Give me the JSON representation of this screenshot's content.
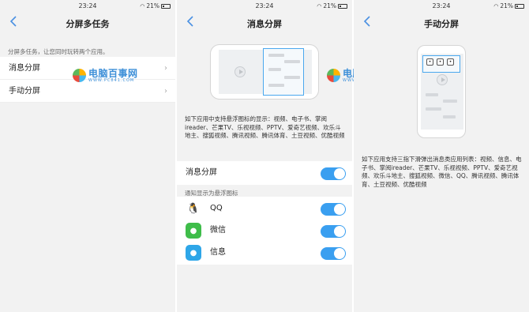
{
  "status": {
    "time": "23:24",
    "battery": "21%"
  },
  "screen1": {
    "title": "分屏多任务",
    "hint": "分屏多任务，让您同时玩转两个应用。",
    "items": [
      {
        "label": "消息分屏"
      },
      {
        "label": "手动分屏"
      }
    ]
  },
  "screen2": {
    "title": "消息分屏",
    "desc": "如下应用中支持悬浮图标的显示：视频、电子书、掌阅ireader、芒果TV、乐视视频、PPTV、爱奇艺视频、欢乐斗地主、搜狐视频、腾讯视频、腾讯体育、土豆视频、优酷视频",
    "toggle_label": "消息分屏",
    "section": "通知显示为悬浮图标",
    "apps": [
      {
        "label": "QQ",
        "icon": "qq-icon"
      },
      {
        "label": "微信",
        "icon": "wechat-icon"
      },
      {
        "label": "信息",
        "icon": "message-icon"
      }
    ]
  },
  "screen3": {
    "title": "手动分屏",
    "desc": "如下应用支持三指下滑弹出消息类应用列表：视频、信息、电子书、掌阅ireader、芒果TV、乐视视频、PPTV、爱奇艺视频、欢乐斗地主、搜狐视频、微信、QQ、腾讯视频、腾讯体育、土豆视频、优酷视频"
  },
  "watermark": {
    "name": "电脑百事网",
    "url": "WWW.PC841.COM"
  },
  "colors": {
    "accent": "#3a9ff0",
    "back": "#4a90e2"
  }
}
